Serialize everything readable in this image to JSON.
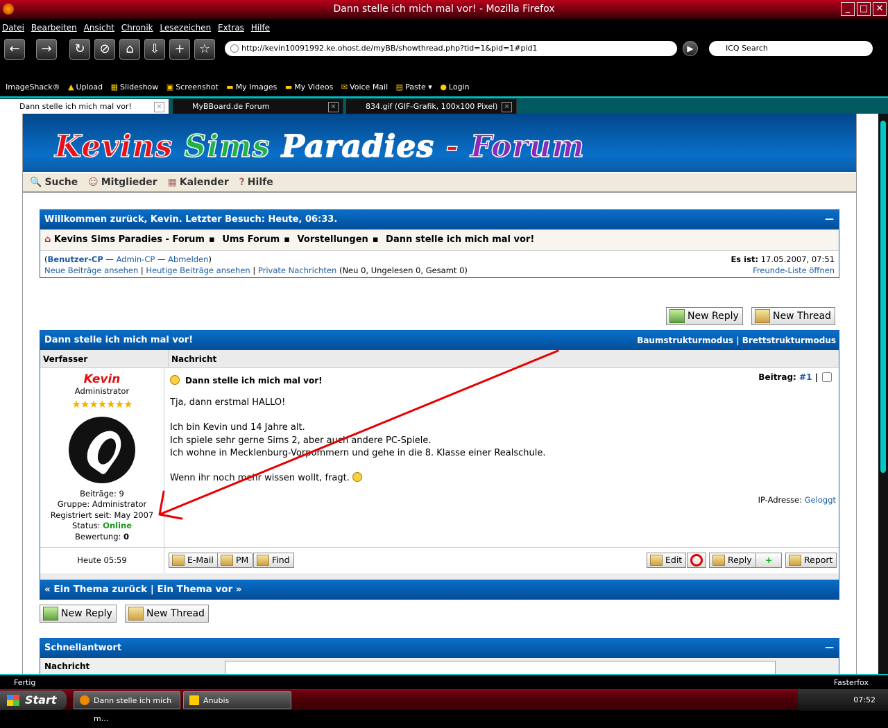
{
  "window": {
    "title": "Dann stelle ich mich mal vor! - Mozilla Firefox"
  },
  "menubar": [
    "Datei",
    "Bearbeiten",
    "Ansicht",
    "Chronik",
    "Lesezeichen",
    "Extras",
    "Hilfe"
  ],
  "nav": {
    "url": "http://kevin10091992.ke.ohost.de/myBB/showthread.php?tid=1&pid=1#pid1",
    "search_placeholder": "ICQ Search"
  },
  "imageshack": {
    "brand": "ImageShack®",
    "items": [
      "Upload",
      "Slideshow",
      "Screenshot",
      "My Images",
      "My Videos",
      "Voice Mail",
      "Paste",
      "Login"
    ]
  },
  "tabs": [
    {
      "label": "Dann stelle ich mich mal vor!"
    },
    {
      "label": "MyBBoard.de Forum"
    },
    {
      "label": "834.gif (GIF-Grafik, 100x100 Pixel)"
    }
  ],
  "forum": {
    "logo": {
      "p1": "Kevins",
      "p2": "Sims",
      "p3": "Paradies",
      "p4": "-",
      "p5": "Forum"
    },
    "menu": [
      "Suche",
      "Mitglieder",
      "Kalender",
      "Hilfe"
    ],
    "welcome": "Willkommen zurück, Kevin. Letzter Besuch: Heute, 06:33.",
    "breadcrumb": [
      "Kevins Sims Paradies - Forum",
      "Ums Forum",
      "Vorstellungen",
      "Dann stelle ich mich mal vor!"
    ],
    "user_links": {
      "ucp": "Benutzer-CP",
      "acp": "Admin-CP",
      "logout": "Abmelden",
      "new_posts": "Neue Beiträge ansehen",
      "today_posts": "Heutige Beiträge ansehen",
      "pm": "Private Nachrichten",
      "pm_counts": "(Neu 0, Ungelesen 0, Gesamt 0)",
      "time_label": "Es ist:",
      "time_value": "17.05.2007, 07:51",
      "buddy": "Freunde-Liste öffnen"
    },
    "buttons": {
      "new_reply": "New Reply",
      "new_thread": "New Thread"
    },
    "thread": {
      "title": "Dann stelle ich mich mal vor!",
      "mode_tree": "Baumstrukturmodus",
      "mode_linear": "Brettstrukturmodus",
      "col_author": "Verfasser",
      "col_message": "Nachricht"
    },
    "post": {
      "author": "Kevin",
      "rank": "Administrator",
      "stars": "★★★★★★★",
      "posts_label": "Beiträge:",
      "posts": "9",
      "group_label": "Gruppe:",
      "group": "Administrator",
      "reg_label": "Registriert seit:",
      "reg": "May 2007",
      "status_label": "Status:",
      "status": "Online",
      "rating_label": "Bewertung:",
      "rating": "0",
      "subject": "Dann stelle ich mich mal vor!",
      "number_label": "Beitrag:",
      "number": "#1",
      "line1": "Tja, dann erstmal HALLO!",
      "line2": "Ich bin Kevin und 14 Jahre alt.",
      "line3": "Ich spiele sehr gerne Sims 2, aber auch andere PC-Spiele.",
      "line4": "Ich wohne in Mecklenburg-Vorpommern und gehe in die 8. Klasse einer Realschule.",
      "line5": "Wenn ihr noch mehr wissen wollt, fragt.",
      "ip_label": "IP-Adresse:",
      "ip": "Geloggt",
      "time": "Heute 05:59",
      "btn_email": "E-Mail",
      "btn_pm": "PM",
      "btn_find": "Find",
      "btn_edit": "Edit",
      "btn_reply": "Reply",
      "btn_report": "Report"
    },
    "thread_nav": "« Ein Thema zurück | Ein Thema vor »",
    "quick_reply": {
      "title": "Schnellantwort",
      "message": "Nachricht"
    }
  },
  "status": {
    "left": "Fertig",
    "right": "Fasterfox"
  },
  "taskbar": {
    "start": "Start",
    "task1": "Dann stelle ich mich m...",
    "task2": "Anubis",
    "clock": "07:52"
  }
}
